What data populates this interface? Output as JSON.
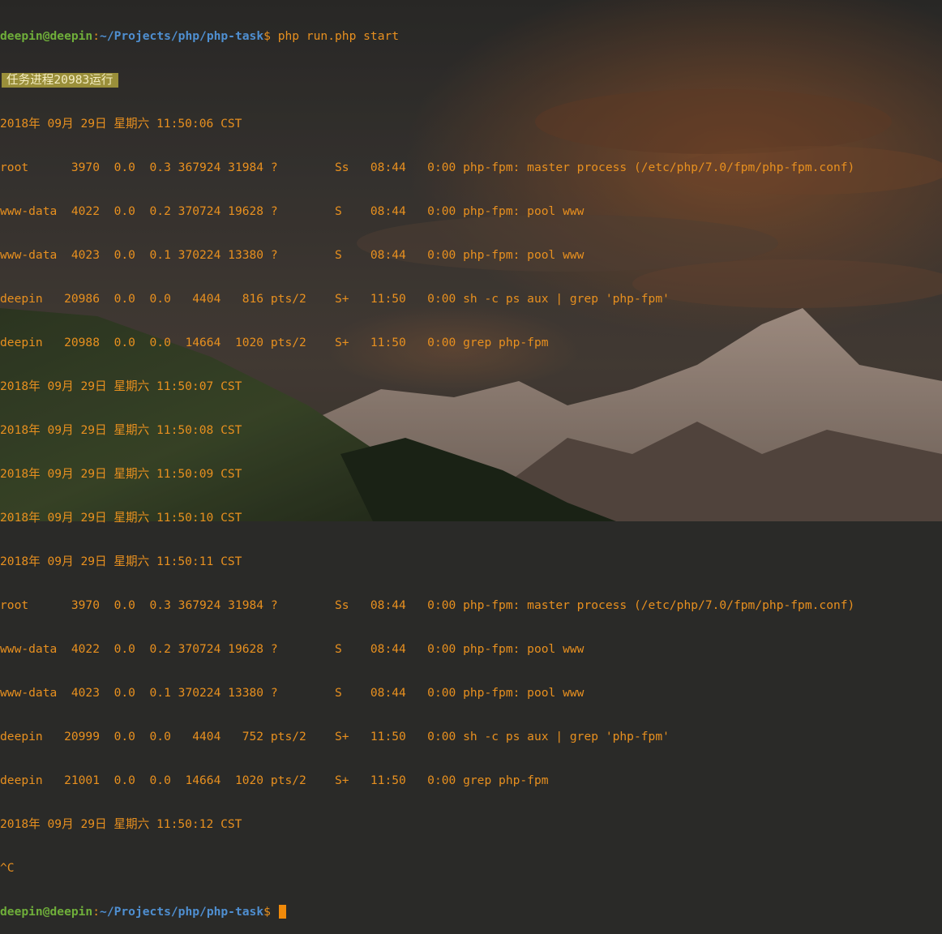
{
  "prompt": {
    "user_host": "deepin@deepin",
    "sep": ":",
    "path": "~/Projects/php/php-task",
    "symbol": "$",
    "command": " php run.php start"
  },
  "badge": "任务进程20983运行",
  "lines": [
    "2018年 09月 29日 星期六 11:50:06 CST",
    "root      3970  0.0  0.3 367924 31984 ?        Ss   08:44   0:00 php-fpm: master process (/etc/php/7.0/fpm/php-fpm.conf)",
    "www-data  4022  0.0  0.2 370724 19628 ?        S    08:44   0:00 php-fpm: pool www",
    "www-data  4023  0.0  0.1 370224 13380 ?        S    08:44   0:00 php-fpm: pool www",
    "deepin   20986  0.0  0.0   4404   816 pts/2    S+   11:50   0:00 sh -c ps aux | grep 'php-fpm'",
    "deepin   20988  0.0  0.0  14664  1020 pts/2    S+   11:50   0:00 grep php-fpm",
    "2018年 09月 29日 星期六 11:50:07 CST",
    "2018年 09月 29日 星期六 11:50:08 CST",
    "2018年 09月 29日 星期六 11:50:09 CST",
    "2018年 09月 29日 星期六 11:50:10 CST",
    "2018年 09月 29日 星期六 11:50:11 CST",
    "root      3970  0.0  0.3 367924 31984 ?        Ss   08:44   0:00 php-fpm: master process (/etc/php/7.0/fpm/php-fpm.conf)",
    "www-data  4022  0.0  0.2 370724 19628 ?        S    08:44   0:00 php-fpm: pool www",
    "www-data  4023  0.0  0.1 370224 13380 ?        S    08:44   0:00 php-fpm: pool www",
    "deepin   20999  0.0  0.0   4404   752 pts/2    S+   11:50   0:00 sh -c ps aux | grep 'php-fpm'",
    "deepin   21001  0.0  0.0  14664  1020 pts/2    S+   11:50   0:00 grep php-fpm",
    "2018年 09月 29日 星期六 11:50:12 CST",
    "^C"
  ],
  "prompt2": {
    "user_host": "deepin@deepin",
    "sep": ":",
    "path": "~/Projects/php/php-task",
    "symbol": "$"
  },
  "colors": {
    "output": "#e8901f",
    "user": "#6fae3a",
    "path": "#4f8fd1",
    "cursor": "#f08a0a",
    "badge_bg": "#9a8f3a"
  }
}
